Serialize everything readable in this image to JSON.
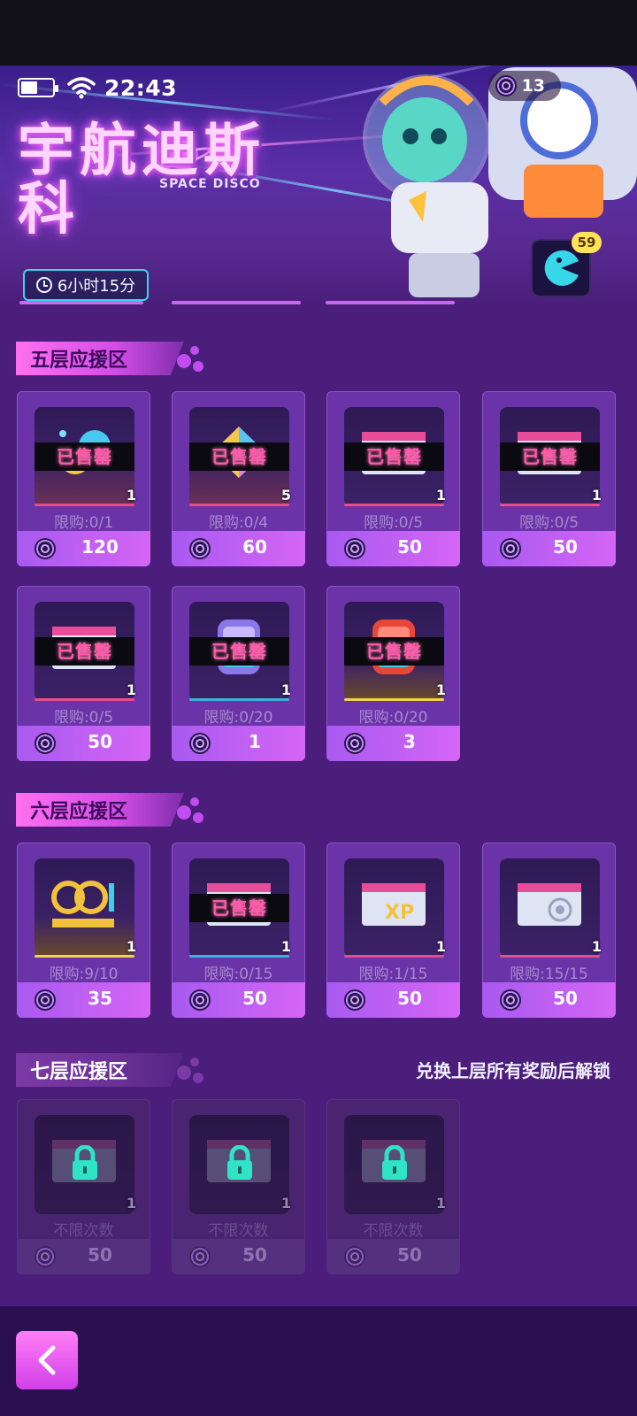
{
  "status": {
    "time": "22:43"
  },
  "currency": {
    "amount": "13"
  },
  "banner": {
    "title_cn": "宇航迪斯科",
    "title_en": "SPACE DISCO"
  },
  "timer": {
    "label": "6小时15分"
  },
  "pacman_badge": "59",
  "sections": [
    {
      "title": "五层应援区",
      "note": ""
    },
    {
      "title": "六层应援区",
      "note": ""
    },
    {
      "title": "七层应援区",
      "note": "兑换上层所有奖励后解锁"
    }
  ],
  "sold_out_label": "已售罄",
  "items": [
    {
      "name": "candy",
      "qty": "1",
      "limit": "限购:0/1",
      "price": "120",
      "sold_out": true
    },
    {
      "name": "prism",
      "qty": "5",
      "limit": "限购:0/4",
      "price": "60",
      "sold_out": true
    },
    {
      "name": "card-blue",
      "qty": "1",
      "limit": "限购:0/5",
      "price": "50",
      "sold_out": true
    },
    {
      "name": "card-gold",
      "qty": "1",
      "limit": "限购:0/5",
      "price": "50",
      "sold_out": true
    },
    {
      "name": "card-silver",
      "qty": "1",
      "limit": "限购:0/5",
      "price": "50",
      "sold_out": true
    },
    {
      "name": "capsule-purple",
      "qty": "1",
      "limit": "限购:0/20",
      "price": "1",
      "sold_out": true
    },
    {
      "name": "capsule-red",
      "qty": "1",
      "limit": "限购:0/20",
      "price": "3",
      "sold_out": true
    },
    {
      "name": "cocoon",
      "qty": "1",
      "limit": "限购:9/10",
      "price": "35",
      "sold_out": false
    },
    {
      "name": "card-blue-2",
      "qty": "1",
      "limit": "限购:0/15",
      "price": "50",
      "sold_out": true
    },
    {
      "name": "card-xp",
      "qty": "1",
      "limit": "限购:1/15",
      "price": "50",
      "sold_out": false
    },
    {
      "name": "card-target",
      "qty": "1",
      "limit": "限购:15/15",
      "price": "50",
      "sold_out": false
    },
    {
      "name": "locked-1",
      "qty": "1",
      "limit": "不限次数",
      "price": "50",
      "sold_out": false
    },
    {
      "name": "locked-2",
      "qty": "1",
      "limit": "不限次数",
      "price": "50",
      "sold_out": false
    },
    {
      "name": "locked-3",
      "qty": "1",
      "limit": "不限次数",
      "price": "50",
      "sold_out": false
    }
  ]
}
